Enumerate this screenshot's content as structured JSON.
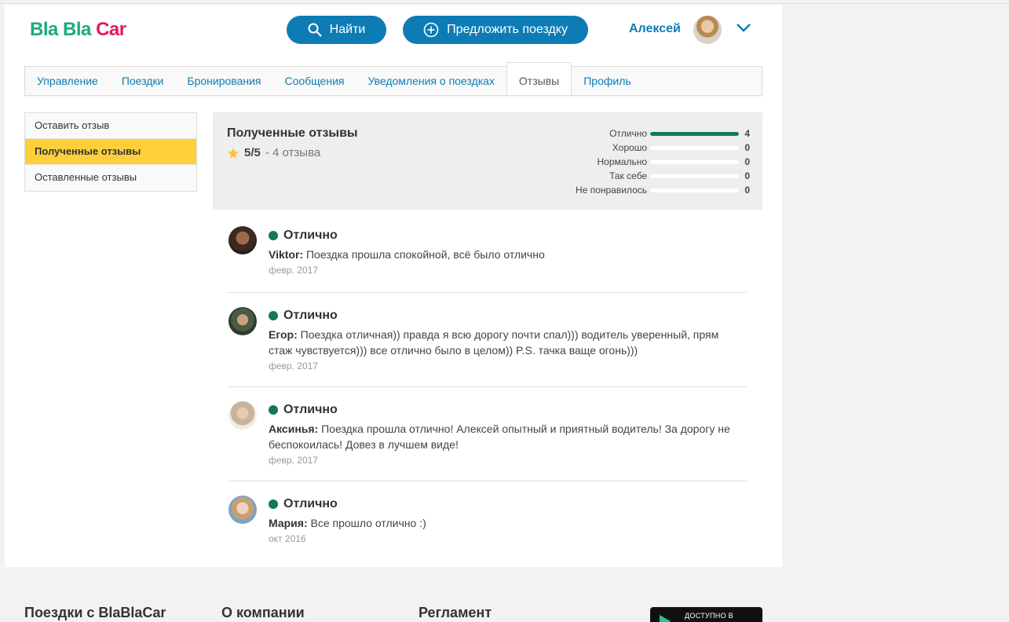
{
  "header": {
    "logo": {
      "part1": "Bla",
      "part2": "Bla",
      "part3": "Car"
    },
    "search_button": "Найти",
    "offer_button": "Предложить поездку",
    "user_name": "Алексей"
  },
  "tabs": [
    {
      "label": "Управление"
    },
    {
      "label": "Поездки"
    },
    {
      "label": "Бронирования"
    },
    {
      "label": "Сообщения"
    },
    {
      "label": "Уведомления о поездках"
    },
    {
      "label": "Отзывы"
    },
    {
      "label": "Профиль"
    }
  ],
  "sidebar": {
    "items": [
      {
        "label": "Оставить отзыв"
      },
      {
        "label": "Полученные отзывы"
      },
      {
        "label": "Оставленные отзывы"
      }
    ]
  },
  "summary": {
    "title": "Полученные отзывы",
    "rating": "5/5",
    "count_text": "- 4 отзыва",
    "distribution": [
      {
        "label": "Отлично",
        "count": "4",
        "fraction": 1.0
      },
      {
        "label": "Хорошо",
        "count": "0",
        "fraction": 0
      },
      {
        "label": "Нормально",
        "count": "0",
        "fraction": 0
      },
      {
        "label": "Так себе",
        "count": "0",
        "fraction": 0
      },
      {
        "label": "Не понравилось",
        "count": "0",
        "fraction": 0
      }
    ],
    "colors": {
      "bar": "#11795a",
      "star": "#fdc032"
    }
  },
  "reviews": [
    {
      "rating": "Отлично",
      "author": "Viktor:",
      "text": "Поездка прошла спокойной, всё было отлично",
      "date": "февр. 2017"
    },
    {
      "rating": "Отлично",
      "author": "Егор:",
      "text": "Поездка отличная)) правда я всю дорогу почти спал))) водитель уверенный, прям стаж чувствуется))) все отлично было в целом)) P.S. тачка ваще огонь)))",
      "date": "февр. 2017"
    },
    {
      "rating": "Отлично",
      "author": "Аксинья:",
      "text": "Поездка прошла отлично! Алексей опытный и приятный водитель! За дорогу не беспокоилась! Довез в лучшем виде!",
      "date": "февр. 2017"
    },
    {
      "rating": "Отлично",
      "author": "Мария:",
      "text": "Все прошло отлично :)",
      "date": "окт 2016"
    }
  ],
  "footer": {
    "col1": "Поездки с BlaBlaCar",
    "col2": "О компании",
    "col3": "Регламент",
    "store_badge": "ДОСТУПНО В"
  }
}
